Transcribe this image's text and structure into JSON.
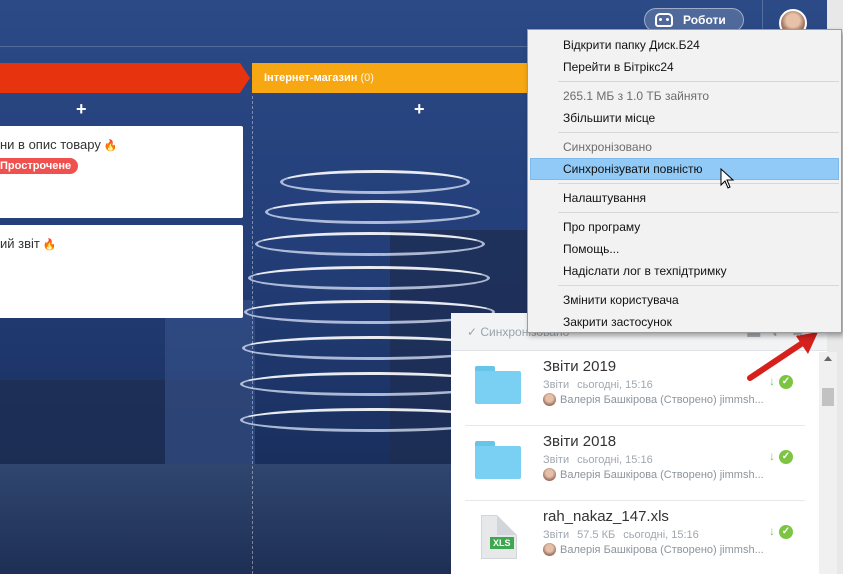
{
  "topbar": {
    "robots_label": "Роботи"
  },
  "kanban": {
    "column_orange": {
      "title": "Інтернет-магазин",
      "count": "(0)"
    },
    "add_symbol": "+",
    "cards": [
      {
        "title": "ни в опис товару",
        "badge": "Прострочене"
      },
      {
        "title": "ий звіт"
      }
    ],
    "fire_symbol": "🔥"
  },
  "menu": {
    "items": [
      {
        "label": "Відкрити папку Диск.Б24",
        "state": "normal"
      },
      {
        "label": "Перейти в Бітрікс24",
        "state": "normal"
      },
      {
        "label": "265.1 МБ з 1.0 ТБ зайнято",
        "state": "disabled"
      },
      {
        "label": "Збільшити місце",
        "state": "normal"
      },
      {
        "label": "Синхронізовано",
        "state": "disabled"
      },
      {
        "label": "Синхронізувати повністю",
        "state": "hover"
      },
      {
        "label": "Налаштування",
        "state": "normal"
      },
      {
        "label": "Про програму",
        "state": "normal"
      },
      {
        "label": "Помощь...",
        "state": "normal"
      },
      {
        "label": "Надіслати лог в техпідтримку",
        "state": "normal"
      },
      {
        "label": "Змінити користувача",
        "state": "normal"
      },
      {
        "label": "Закрити застосунок",
        "state": "normal"
      }
    ]
  },
  "disk": {
    "header_status": "Синхронізовано",
    "items": [
      {
        "type": "folder",
        "name": "Звіти 2019",
        "kind": "Звіти",
        "date": "сьогодні, 15:16",
        "user": "Валерія Башкірова (Створено) jimmsh..."
      },
      {
        "type": "folder",
        "name": "Звіти 2018",
        "kind": "Звіти",
        "date": "сьогодні, 15:16",
        "user": "Валерія Башкірова (Створено) jimmsh..."
      },
      {
        "type": "xls",
        "name": "rah_nakaz_147.xls",
        "kind": "Звіти",
        "size": "57.5 КБ",
        "date": "сьогодні, 15:16",
        "user": "Валерія Башкірова (Створено) jimmsh..."
      }
    ],
    "xls_badge": "XLS"
  },
  "colors": {
    "red_column": "#e8330f",
    "orange_column": "#f7a711",
    "menu_hover": "#91c9f7",
    "sync_ok": "#7cc442"
  },
  "icons": [
    "robot-icon",
    "avatar",
    "fire-icon",
    "check-icon",
    "download-arrow-icon",
    "folder-icon",
    "xls-file-icon",
    "gear-icon",
    "mouse-cursor-icon",
    "red-annotation-arrow"
  ]
}
